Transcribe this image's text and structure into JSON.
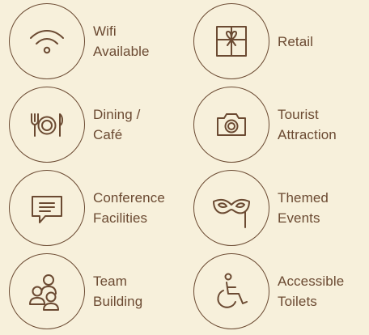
{
  "colors": {
    "background": "#f7f0db",
    "ink": "#6b4a32"
  },
  "amenities": [
    {
      "icon": "wifi-icon",
      "line1": "Wifi",
      "line2": "Available"
    },
    {
      "icon": "gift-box-icon",
      "line1": "Retail",
      "line2": ""
    },
    {
      "icon": "dining-icon",
      "line1": "Dining /",
      "line2": "Café"
    },
    {
      "icon": "camera-icon",
      "line1": "Tourist",
      "line2": "Attraction"
    },
    {
      "icon": "chat-bubble-icon",
      "line1": "Conference",
      "line2": "Facilities"
    },
    {
      "icon": "mask-icon",
      "line1": "Themed",
      "line2": "Events"
    },
    {
      "icon": "team-icon",
      "line1": "Team",
      "line2": "Building"
    },
    {
      "icon": "wheelchair-icon",
      "line1": "Accessible",
      "line2": "Toilets"
    }
  ]
}
